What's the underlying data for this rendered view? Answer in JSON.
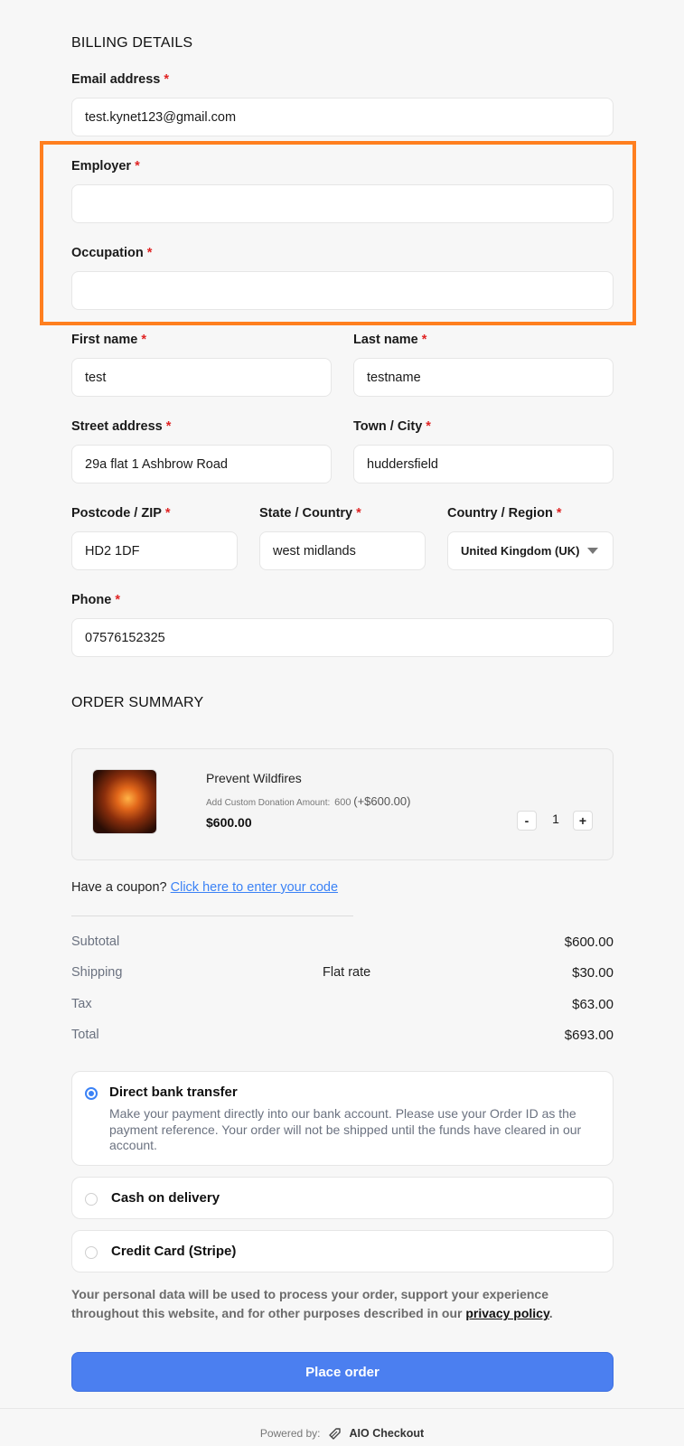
{
  "billing": {
    "title": "BILLING DETAILS",
    "required_mark": "*",
    "email": {
      "label": "Email address",
      "value": "test.kynet123@gmail.com"
    },
    "employer": {
      "label": "Employer",
      "value": ""
    },
    "occupation": {
      "label": "Occupation",
      "value": ""
    },
    "first_name": {
      "label": "First name",
      "value": "test"
    },
    "last_name": {
      "label": "Last name",
      "value": "testname"
    },
    "street": {
      "label": "Street address",
      "value": "29a flat 1 Ashbrow Road"
    },
    "city": {
      "label": "Town / City",
      "value": "huddersfield"
    },
    "postcode": {
      "label": "Postcode / ZIP",
      "value": "HD2 1DF"
    },
    "state": {
      "label": "State / Country",
      "value": "west midlands"
    },
    "country": {
      "label": "Country / Region",
      "value": "United Kingdom (UK)"
    },
    "phone": {
      "label": "Phone",
      "value": "07576152325"
    }
  },
  "order": {
    "title": "ORDER SUMMARY",
    "product": {
      "name": "Prevent Wildfires",
      "custom_label": "Add Custom Donation Amount:",
      "custom_value": "600",
      "custom_extra": "(+$600.00)",
      "price": "$600.00",
      "qty": "1",
      "minus": "-",
      "plus": "+"
    },
    "coupon_text": "Have a coupon?",
    "coupon_link": "Click here to enter your code",
    "subtotal": {
      "label": "Subtotal",
      "value": "$600.00"
    },
    "shipping": {
      "label": "Shipping",
      "method": "Flat rate",
      "value": "$30.00"
    },
    "tax": {
      "label": "Tax",
      "value": "$63.00"
    },
    "total": {
      "label": "Total",
      "value": "$693.00"
    }
  },
  "payment": {
    "bank": {
      "title": "Direct bank transfer",
      "desc": "Make your payment directly into our bank account. Please use your Order ID as the payment reference. Your order will not be shipped until the funds have cleared in our account.",
      "selected": true
    },
    "cod": {
      "title": "Cash on delivery",
      "selected": false
    },
    "stripe": {
      "title": "Credit Card (Stripe)",
      "selected": false
    }
  },
  "privacy": {
    "text": "Your personal data will be used to process your order, support your experience throughout this website, and for other purposes described in our",
    "link": "privacy policy",
    "end": "."
  },
  "place_order": "Place order",
  "footer": {
    "powered_by": "Powered by:",
    "brand": "AIO Checkout"
  },
  "colors": {
    "accent": "#4b7ff0",
    "highlight": "#ff7f1f",
    "required": "#e02424"
  }
}
